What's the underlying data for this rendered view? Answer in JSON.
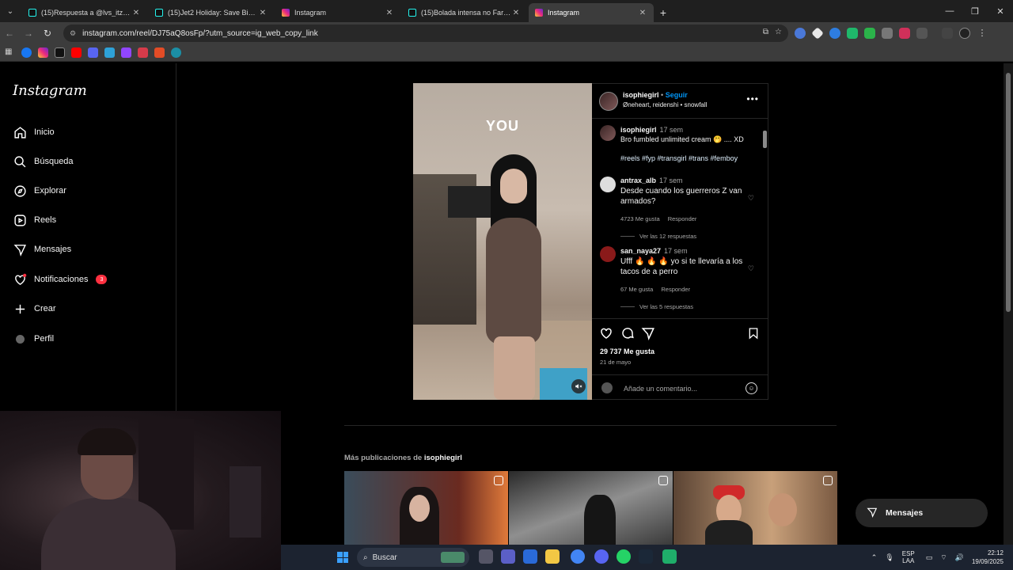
{
  "browser": {
    "tabs": [
      {
        "label": "(15)Respuesta a @lvs_itzeel Me",
        "favicon": "tiktok-icon",
        "active": false
      },
      {
        "label": "(15)Jet2 Holiday: Save Big on Fa",
        "favicon": "tiktok-icon",
        "active": false
      },
      {
        "label": "Instagram",
        "favicon": "instagram-icon",
        "active": false
      },
      {
        "label": "(15)Bolada intensa no Farol da I",
        "favicon": "tiktok-icon",
        "active": false
      },
      {
        "label": "Instagram",
        "favicon": "instagram-icon",
        "active": true
      }
    ],
    "url": "instagram.com/reel/DJ75aQ8osFp/?utm_source=ig_web_copy_link"
  },
  "sidebar": {
    "logo": "Instagram",
    "items": [
      {
        "label": "Inicio",
        "icon": "home-icon"
      },
      {
        "label": "Búsqueda",
        "icon": "search-icon"
      },
      {
        "label": "Explorar",
        "icon": "compass-icon"
      },
      {
        "label": "Reels",
        "icon": "reels-icon"
      },
      {
        "label": "Mensajes",
        "icon": "messenger-icon"
      },
      {
        "label": "Notificaciones",
        "icon": "heart-icon",
        "badge": "3"
      },
      {
        "label": "Crear",
        "icon": "plus-icon"
      },
      {
        "label": "Perfil",
        "icon": "profile-avatar"
      }
    ]
  },
  "reel": {
    "overlay_text": "YOU",
    "author": "isophiegirl",
    "separator": "•",
    "follow_label": "Seguir",
    "audio": "Øneheart, reidenshi • snowfall",
    "caption": {
      "user": "isophiegirl",
      "time": "17 sem",
      "text": "Bro fumbled unlimited cream 🤭 .... XD",
      "tags": "#reels #fyp #transgirl #trans #femboy"
    },
    "comments": [
      {
        "user": "antrax_alb",
        "time": "17 sem",
        "text": "Desde cuando los guerreros Z van armados?",
        "likes": "4723 Me gusta",
        "reply": "Responder",
        "replies": "Ver las 12 respuestas"
      },
      {
        "user": "san_naya27",
        "time": "17 sem",
        "text": "Ufff 🔥 🔥 🔥 yo si te llevaría a los tacos de a perro",
        "likes": "67 Me gusta",
        "reply": "Responder",
        "replies": "Ver las 5 respuestas"
      }
    ],
    "likes": "29 737 Me gusta",
    "date": "21 de mayo",
    "comment_placeholder": "Añade un comentario..."
  },
  "more_posts": {
    "prefix": "Más publicaciones de",
    "user": "isophiegirl"
  },
  "floating_messages": "Mensajes",
  "taskbar": {
    "search": "Buscar",
    "lang_top": "ESP",
    "lang_bottom": "LAA",
    "time": "22:12",
    "date": "19/09/2025"
  },
  "colors": {
    "accent": "#0095f6",
    "badge": "#ff3040",
    "background": "#000000"
  }
}
